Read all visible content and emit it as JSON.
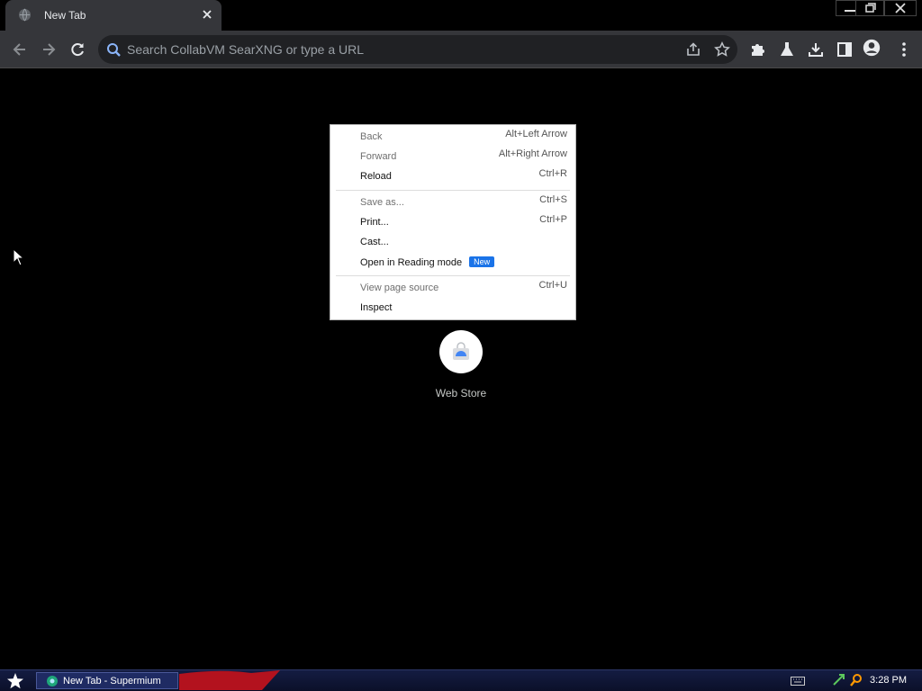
{
  "tab": {
    "title": "New Tab",
    "icon": "globe-icon"
  },
  "window_controls": [
    "minimize-icon",
    "restore-icon",
    "close-icon"
  ],
  "omnibox": {
    "placeholder": "Search CollabVM SearXNG or type a URL"
  },
  "context_menu": {
    "items": [
      {
        "label": "Back",
        "shortcut": "Alt+Left Arrow",
        "enabled": false
      },
      {
        "label": "Forward",
        "shortcut": "Alt+Right Arrow",
        "enabled": false
      },
      {
        "label": "Reload",
        "shortcut": "Ctrl+R",
        "enabled": true
      },
      {
        "label": "Save as...",
        "shortcut": "Ctrl+S",
        "enabled": false
      },
      {
        "label": "Print...",
        "shortcut": "Ctrl+P",
        "enabled": true
      },
      {
        "label": "Cast...",
        "shortcut": "",
        "enabled": true
      },
      {
        "label": "Open in Reading mode",
        "shortcut": "",
        "badge": "New",
        "enabled": true
      },
      {
        "label": "View page source",
        "shortcut": "Ctrl+U",
        "enabled": false
      },
      {
        "label": "Inspect",
        "shortcut": "",
        "enabled": true
      }
    ]
  },
  "shortcut_tile": {
    "label": "Web Store",
    "icon": "web-store-icon"
  },
  "taskbar": {
    "task_label": "New Tab - Supermium",
    "clock": "3:28 PM"
  },
  "colors": {
    "accent": "#1a73e8",
    "toolbar": "#35363a",
    "omnibox": "#202124",
    "taskbar": "#141c42"
  }
}
